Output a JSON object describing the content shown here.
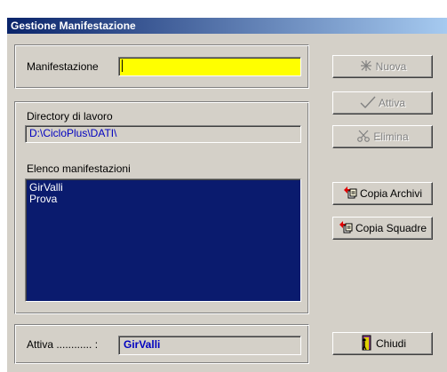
{
  "window": {
    "title": "Gestione Manifestazione"
  },
  "manifestazione": {
    "label": "Manifestazione",
    "value": ""
  },
  "directory": {
    "label": "Directory di lavoro",
    "value": "D:\\CicloPlus\\DATI\\"
  },
  "elenco": {
    "label": "Elenco manifestazioni",
    "items": [
      "GirValli",
      "Prova"
    ]
  },
  "attiva": {
    "label": "Attiva ............ :",
    "value": "GirValli"
  },
  "buttons": {
    "nuova": "Nuova",
    "attiva": "Attiva",
    "elimina": "Elimina",
    "copia_archivi": "Copia Archivi",
    "copia_squadre": "Copia Squadre",
    "chiudi": "Chiudi"
  },
  "icons": {
    "nuova": "new-sparkle-icon",
    "attiva": "checkmark-icon",
    "elimina": "delete-scissors-icon",
    "copia_archivi": "copy-documents-icon",
    "copia_squadre": "copy-documents-icon",
    "chiudi": "exit-door-icon"
  },
  "colors": {
    "title_start": "#0a246a",
    "title_end": "#a6caf0",
    "input_highlight": "#ffff00",
    "list_bg": "#0a1b6e",
    "value_text": "#0000c0"
  }
}
